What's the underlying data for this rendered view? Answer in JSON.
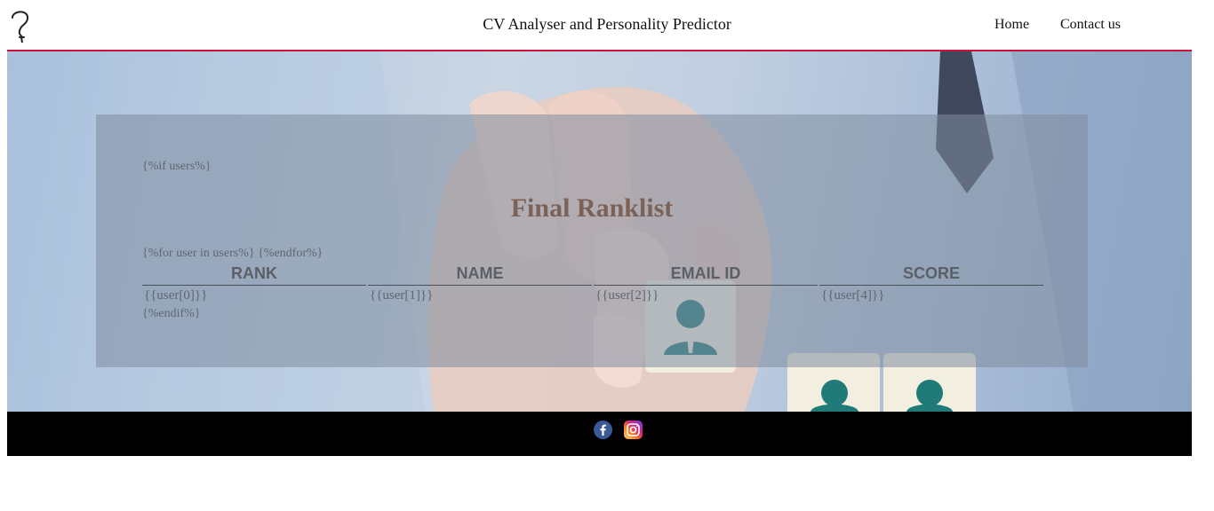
{
  "header": {
    "logo_icon": "question-ear-icon",
    "title": "CV Analyser and Personality Predictor",
    "nav": [
      {
        "label": "Home"
      },
      {
        "label": "Contact us"
      }
    ],
    "accent_color": "#c8143c"
  },
  "hero": {
    "background_image": "hand-placing-person-tiles"
  },
  "panel": {
    "if_tag": "{%if users%}",
    "title": "Final Ranklist",
    "for_tag": "{%for user in users%} {%endfor%}",
    "columns": [
      "RANK",
      "NAME",
      "EMAIL ID",
      "SCORE"
    ],
    "row": [
      "{{user[0]}}",
      "{{user[1]}}",
      "{{user[2]}}",
      "{{user[4]}}"
    ],
    "endif_tag": "{%endif%}"
  },
  "footer": {
    "social": [
      {
        "icon": "facebook-icon",
        "color": "#3b5998"
      },
      {
        "icon": "instagram-icon",
        "color": "#c13584"
      }
    ]
  }
}
